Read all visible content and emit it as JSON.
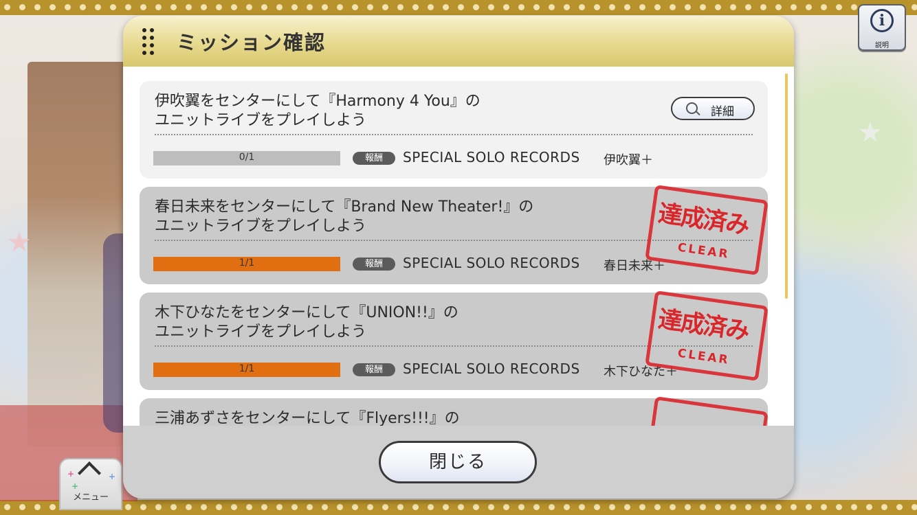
{
  "dialog": {
    "title": "ミッション確認",
    "close_label": "閉じる"
  },
  "info_button": {
    "label": "説明",
    "icon": "info-icon"
  },
  "menu_button": {
    "label": "メニュー",
    "icon": "chevron-up-icon"
  },
  "missions": [
    {
      "title_line1": "伊吹翼をセンターにして『Harmony 4 You』の",
      "title_line2": "ユニットライブをプレイしよう",
      "progress": "0/1",
      "progress_fraction": 0,
      "reward_badge": "報酬",
      "reward_name": "SPECIAL SOLO RECORDS",
      "reward_item": "伊吹翼＋",
      "detail_label": "詳細",
      "cleared": false
    },
    {
      "title_line1": "春日未来をセンターにして『Brand New Theater!』の",
      "title_line2": "ユニットライブをプレイしよう",
      "progress": "1/1",
      "progress_fraction": 1,
      "reward_badge": "報酬",
      "reward_name": "SPECIAL SOLO RECORDS",
      "reward_item": "春日未来＋",
      "stamp_text": "達成済み",
      "stamp_sub": "CLEAR",
      "cleared": true
    },
    {
      "title_line1": "木下ひなたをセンターにして『UNION!!』の",
      "title_line2": "ユニットライブをプレイしよう",
      "progress": "1/1",
      "progress_fraction": 1,
      "reward_badge": "報酬",
      "reward_name": "SPECIAL SOLO RECORDS",
      "reward_item": "木下ひなた＋",
      "stamp_text": "達成済み",
      "stamp_sub": "CLEAR",
      "cleared": true
    },
    {
      "title_line1": "三浦あずさをセンターにして『Flyers!!!』の",
      "cleared": true
    }
  ],
  "colors": {
    "header_gold": "#e7d98e",
    "progress_done": "#e16e10",
    "progress_empty": "#bdbdbd",
    "stamp_red": "#d9262b"
  }
}
